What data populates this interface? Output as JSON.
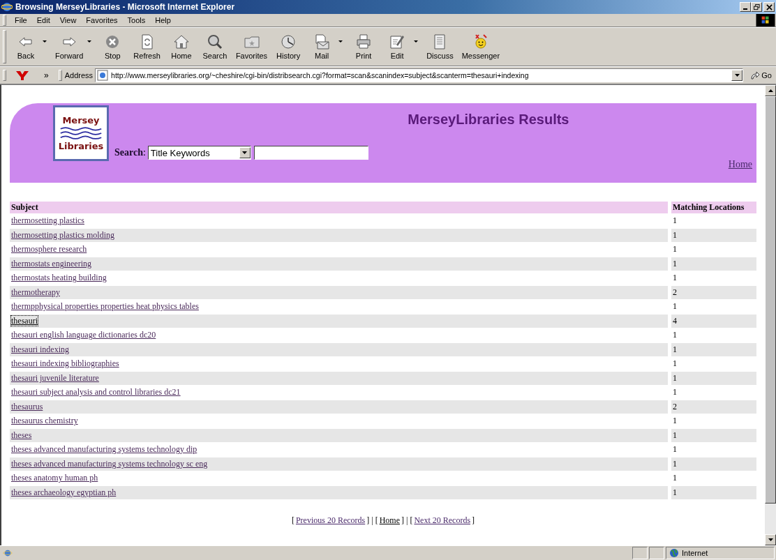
{
  "window": {
    "title": "Browsing MerseyLibraries - Microsoft Internet Explorer"
  },
  "menu": [
    "File",
    "Edit",
    "View",
    "Favorites",
    "Tools",
    "Help"
  ],
  "toolbar": [
    {
      "kind": "back",
      "label": "Back",
      "dropdown": true
    },
    {
      "kind": "forward",
      "label": "Forward",
      "dropdown": true
    },
    {
      "kind": "stop",
      "label": "Stop",
      "dropdown": false
    },
    {
      "kind": "refresh",
      "label": "Refresh",
      "dropdown": false
    },
    {
      "kind": "home",
      "label": "Home",
      "dropdown": false
    },
    {
      "kind": "search",
      "label": "Search",
      "dropdown": false
    },
    {
      "kind": "favorites",
      "label": "Favorites",
      "dropdown": false
    },
    {
      "kind": "history",
      "label": "History",
      "dropdown": false
    },
    {
      "kind": "mail",
      "label": "Mail",
      "dropdown": true
    },
    {
      "kind": "print",
      "label": "Print",
      "dropdown": false
    },
    {
      "kind": "edit",
      "label": "Edit",
      "dropdown": true
    },
    {
      "kind": "discuss",
      "label": "Discuss",
      "dropdown": false
    },
    {
      "kind": "messenger",
      "label": "Messenger",
      "dropdown": false
    }
  ],
  "address_bar": {
    "chevron": "»",
    "label": "Address",
    "value": "http://www.merseylibraries.org/~cheshire/cgi-bin/distribsearch.cgi?format=scan&scanindex=subject&scanterm=thesauri+indexing",
    "go": "Go"
  },
  "page": {
    "logo": {
      "top": "Mersey",
      "bottom": "Libraries"
    },
    "heading": "MerseyLibraries Results",
    "search_label": "Search",
    "search_colon": ":",
    "search_select": "Title Keywords",
    "home_link": "Home"
  },
  "table": {
    "columns": [
      "Subject",
      "Matching Locations"
    ],
    "rows": [
      {
        "subject": "thermosetting plastics",
        "count": "1",
        "focused": false
      },
      {
        "subject": "thermosetting plastics molding",
        "count": "1",
        "focused": false
      },
      {
        "subject": "thermosphere research",
        "count": "1",
        "focused": false
      },
      {
        "subject": "thermostats engineering",
        "count": "1",
        "focused": false
      },
      {
        "subject": "thermostats heating building",
        "count": "1",
        "focused": false
      },
      {
        "subject": "thermotherapy",
        "count": "2",
        "focused": false
      },
      {
        "subject": "thermpphysical properties properties heat physics tables",
        "count": "1",
        "focused": false
      },
      {
        "subject": "thesauri",
        "count": "4",
        "focused": true
      },
      {
        "subject": "thesauri english language dictionaries dc20",
        "count": "1",
        "focused": false
      },
      {
        "subject": "thesauri indexing",
        "count": "1",
        "focused": false
      },
      {
        "subject": "thesauri indexing bibliographies",
        "count": "1",
        "focused": false
      },
      {
        "subject": "thesauri juvenile literature",
        "count": "1",
        "focused": false
      },
      {
        "subject": "thesauri subject analysis and control libraries dc21",
        "count": "1",
        "focused": false
      },
      {
        "subject": "thesaurus",
        "count": "2",
        "focused": false
      },
      {
        "subject": "thesaurus chemistry",
        "count": "1",
        "focused": false
      },
      {
        "subject": "theses",
        "count": "1",
        "focused": false
      },
      {
        "subject": "theses advanced manufacturing systems technology dip",
        "count": "1",
        "focused": false
      },
      {
        "subject": "theses advanced manufacturing systems technology sc eng",
        "count": "1",
        "focused": false
      },
      {
        "subject": "theses anatomy human ph",
        "count": "1",
        "focused": false
      },
      {
        "subject": "theses archaeology egyptian ph",
        "count": "1",
        "focused": false
      }
    ]
  },
  "pager": [
    {
      "kind": "text",
      "text": "["
    },
    {
      "kind": "link",
      "text": "Previous 20 Records",
      "visited": true
    },
    {
      "kind": "text",
      "text": "] | ["
    },
    {
      "kind": "link",
      "text": "Home",
      "visited": false
    },
    {
      "kind": "text",
      "text": "] | ["
    },
    {
      "kind": "link",
      "text": "Next 20 Records",
      "visited": true
    },
    {
      "kind": "text",
      "text": "]"
    }
  ],
  "status_bar": {
    "zone": "Internet"
  }
}
